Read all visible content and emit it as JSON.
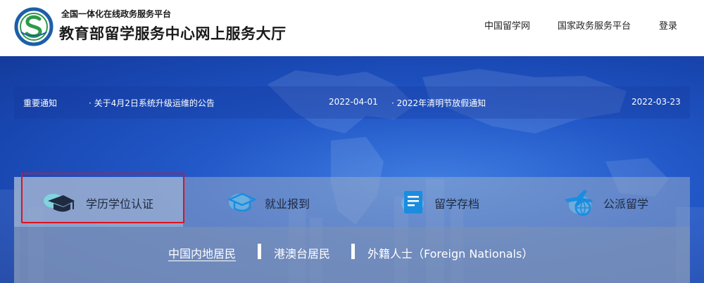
{
  "header": {
    "subtitle": "全国一体化在线政务服务平台",
    "title": "教育部留学服务中心网上服务大厅",
    "nav": [
      "中国留学网",
      "国家政务服务平台",
      "登录"
    ]
  },
  "notices": {
    "label": "重要通知",
    "items": [
      {
        "title": "· 关于4月2日系统升级运维的公告",
        "date": "2022-04-01"
      },
      {
        "title": "· 2022年清明节放假通知",
        "date": "2022-03-23"
      }
    ]
  },
  "services": {
    "tiles": [
      {
        "label": "学历学位认证",
        "icon": "graduation-cap-icon",
        "selected": true
      },
      {
        "label": "就业报到",
        "icon": "graduation-cap-outline-icon",
        "selected": false
      },
      {
        "label": "留学存档",
        "icon": "document-folder-icon",
        "selected": false
      },
      {
        "label": "公派留学",
        "icon": "airplane-globe-icon",
        "selected": false
      }
    ],
    "sub_tabs": [
      {
        "label": "中国内地居民",
        "selected": true
      },
      {
        "label": "港澳台居民",
        "selected": false
      },
      {
        "label": "外籍人士（Foreign Nationals）",
        "selected": false
      }
    ]
  },
  "colors": {
    "accent_blue": "#2258c8",
    "highlight_red": "#e0101c",
    "logo_green": "#2f9a4a"
  }
}
